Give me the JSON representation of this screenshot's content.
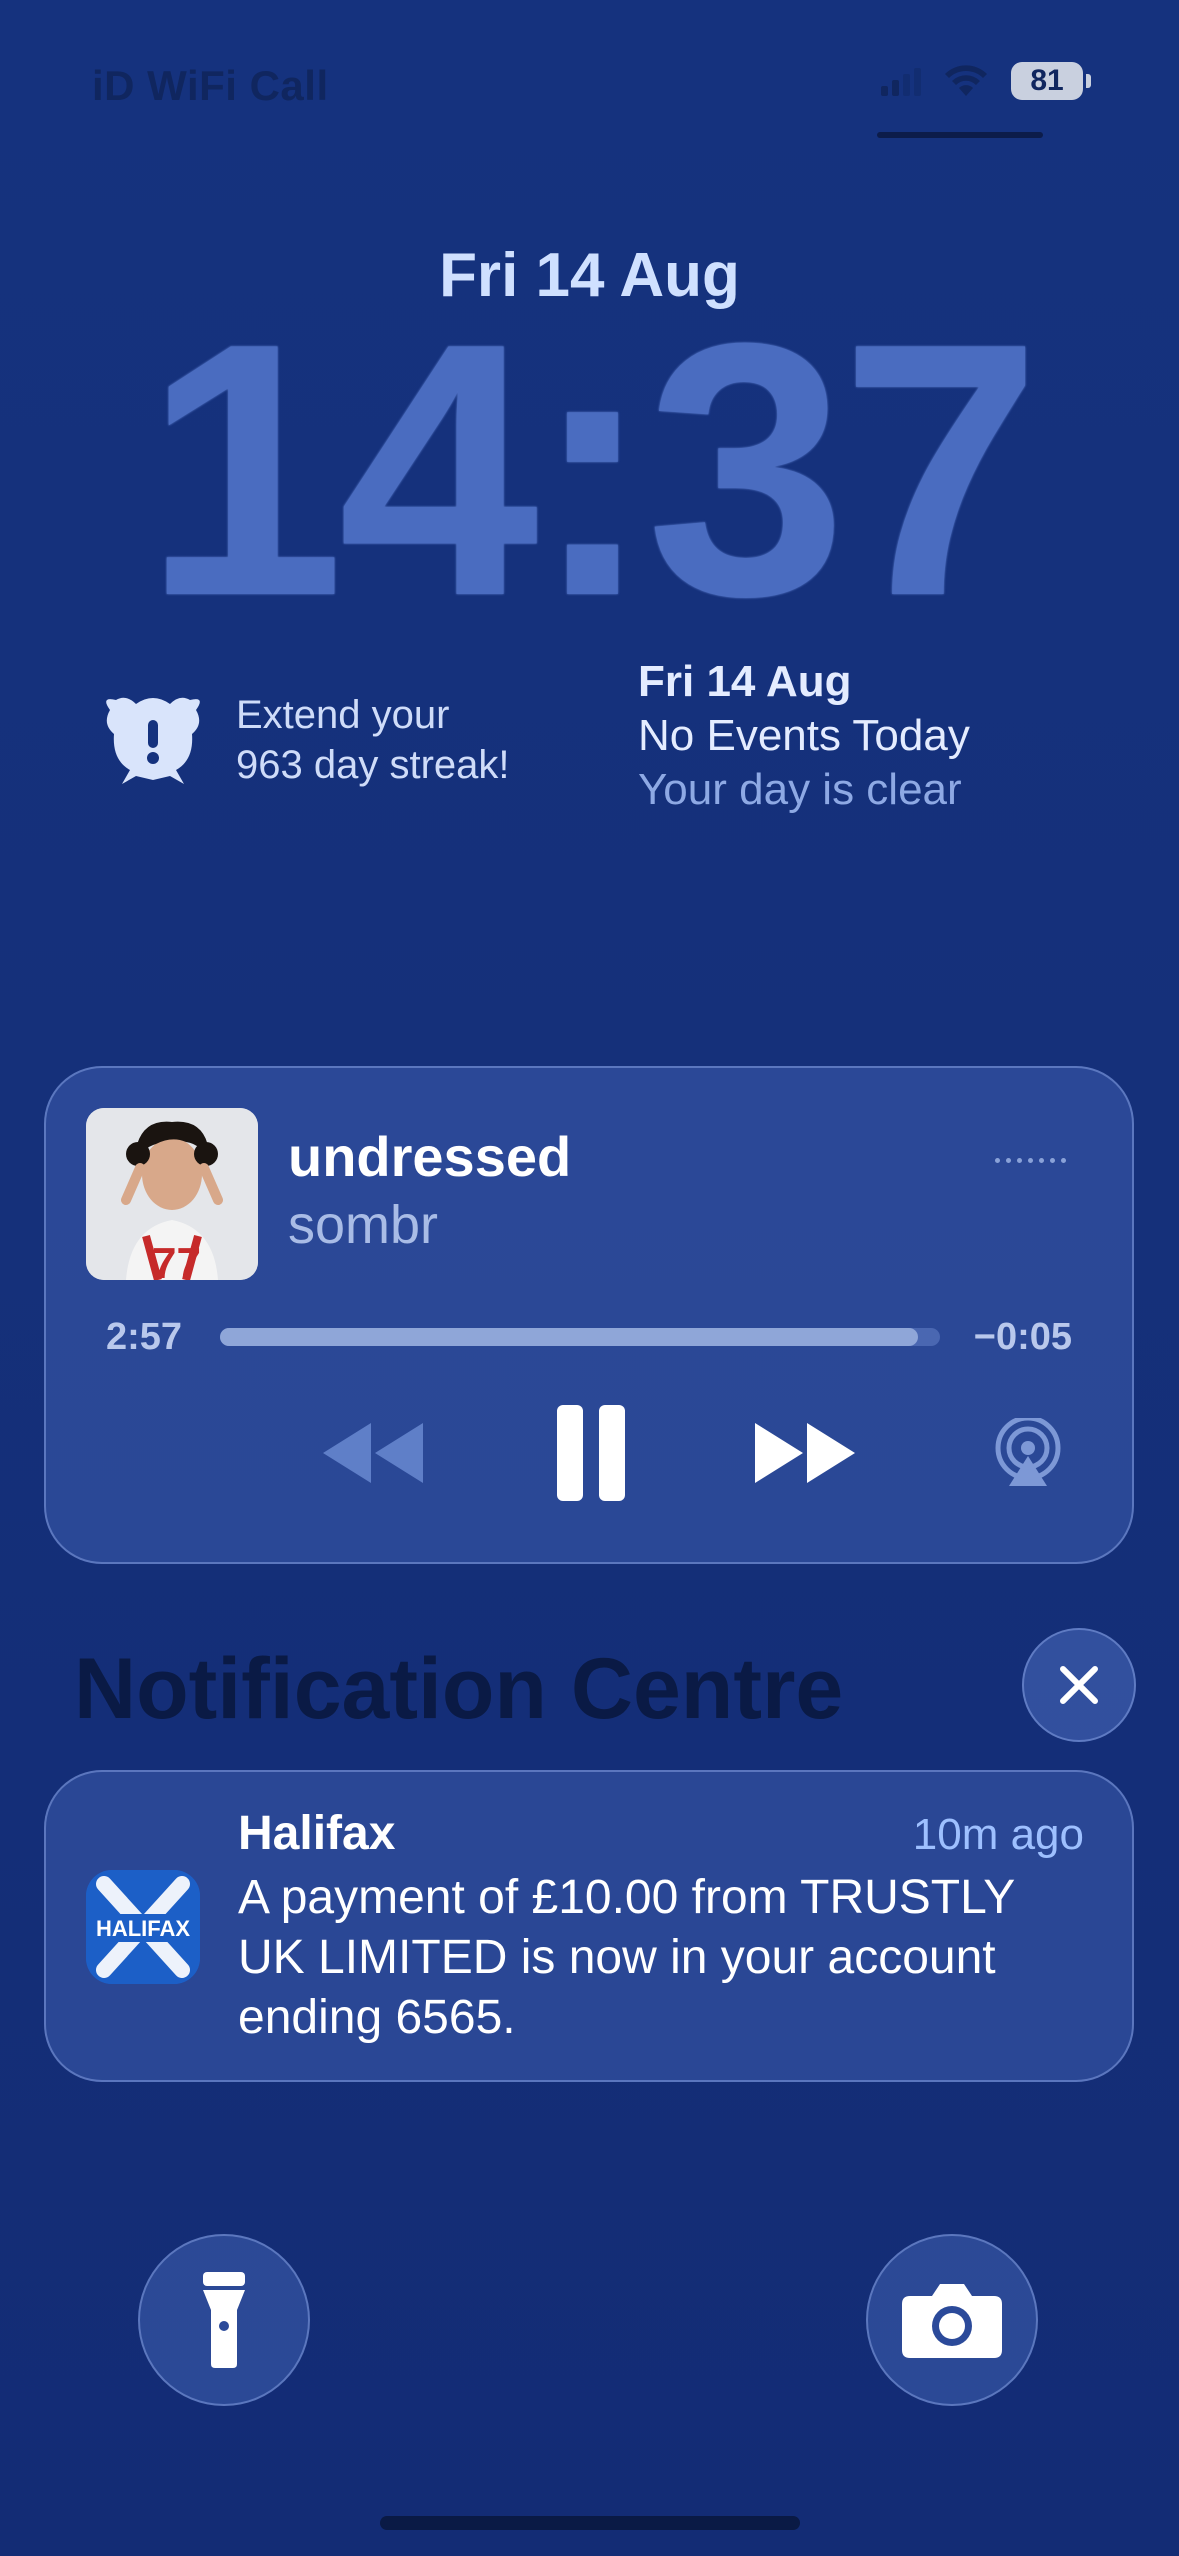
{
  "status_bar": {
    "carrier": "iD WiFi Call",
    "battery": "81"
  },
  "lock_screen": {
    "date": "Fri 14 Aug",
    "time": "14:37"
  },
  "widgets": {
    "streak": {
      "line1": "Extend your",
      "line2": "963 day streak!",
      "icon": "streak-mascot-icon"
    },
    "calendar": {
      "date": "Fri 14 Aug",
      "events": "No Events Today",
      "subtitle": "Your day is clear"
    }
  },
  "now_playing": {
    "title": "undressed",
    "artist": "sombr",
    "elapsed": "2:57",
    "remaining": "−0:05",
    "progress_fraction": 0.97,
    "controls": [
      "rewind-icon",
      "pause-icon",
      "fast-forward-icon",
      "airplay-icon"
    ]
  },
  "notification_centre": {
    "title": "Notification Centre",
    "notifications": [
      {
        "app": "Halifax",
        "time": "10m ago",
        "body": "A payment of £10.00 from TRUSTLY UK LIMITED is now in your account ending 6565.",
        "icon_label": "HALIFAX"
      }
    ]
  },
  "quick_actions": [
    "flashlight-icon",
    "camera-icon"
  ]
}
